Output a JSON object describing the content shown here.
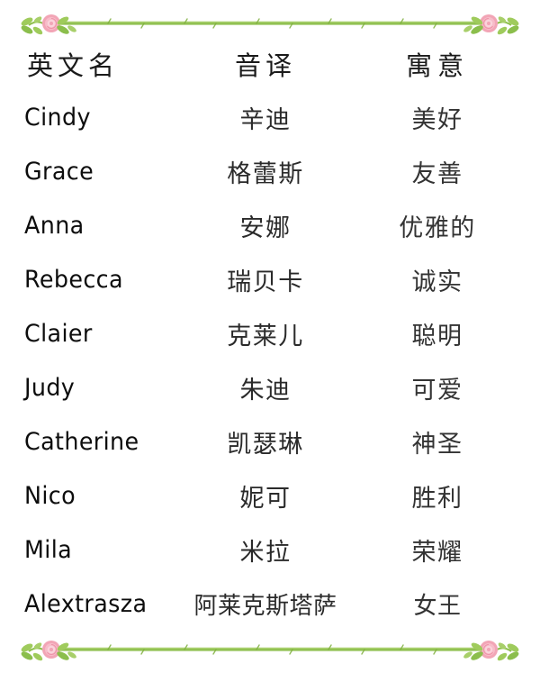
{
  "document": {
    "background_color": "#ffffff",
    "decoration": {
      "top_divider_name": "floral-rose-vine-divider",
      "bottom_divider_name": "floral-rose-vine-divider",
      "vine_color": "#8CBE4A",
      "leaf_color": "#9FCB5C",
      "rose_color": "#F2A5B6",
      "rose_center_color": "#FAD3DB"
    }
  },
  "table": {
    "headers": {
      "english_name": "英文名",
      "transliteration": "音译",
      "meaning": "寓意"
    },
    "rows": [
      {
        "name": "Cindy",
        "transliteration": "辛迪",
        "meaning": "美好"
      },
      {
        "name": "Grace",
        "transliteration": "格蕾斯",
        "meaning": "友善"
      },
      {
        "name": "Anna",
        "transliteration": "安娜",
        "meaning": "优雅的"
      },
      {
        "name": "Rebecca",
        "transliteration": "瑞贝卡",
        "meaning": "诚实"
      },
      {
        "name": "Claier",
        "transliteration": "克莱儿",
        "meaning": "聪明"
      },
      {
        "name": "Judy",
        "transliteration": "朱迪",
        "meaning": "可爱"
      },
      {
        "name": "Catherine",
        "transliteration": "凯瑟琳",
        "meaning": "神圣"
      },
      {
        "name": "Nico",
        "transliteration": "妮可",
        "meaning": "胜利"
      },
      {
        "name": "Mila",
        "transliteration": "米拉",
        "meaning": "荣耀"
      },
      {
        "name": "Alextrasza",
        "transliteration": "阿莱克斯塔萨",
        "meaning": "女王"
      }
    ]
  }
}
